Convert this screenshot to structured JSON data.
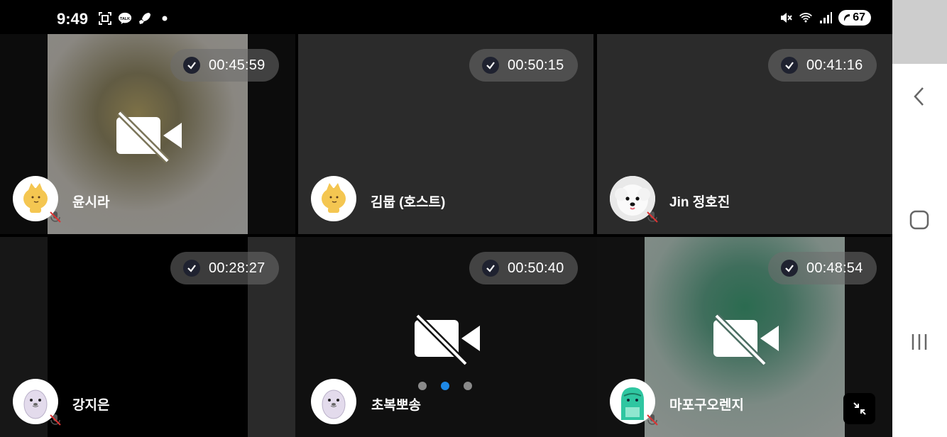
{
  "status": {
    "time": "9:49",
    "battery": "67",
    "left_icons": [
      "screenshot-icon",
      "kakaotalk-icon",
      "rocket-icon",
      "dot-icon"
    ],
    "right_icons": [
      "mute-icon",
      "wifi-icon",
      "signal-icon"
    ]
  },
  "tiles": [
    {
      "name": "윤시라",
      "timer": "00:45:59",
      "camera_off": true,
      "avatar": "yellow-character"
    },
    {
      "name": "김뭅 (호스트)",
      "timer": "00:50:15",
      "camera_off": false,
      "avatar": "yellow-character"
    },
    {
      "name": "Jin 정호진",
      "timer": "00:41:16",
      "camera_off": false,
      "avatar": "white-dog-photo"
    },
    {
      "name": "강지은",
      "timer": "00:28:27",
      "camera_off": false,
      "avatar": "seal-character"
    },
    {
      "name": "초복뽀송",
      "timer": "00:50:40",
      "camera_off": true,
      "avatar": "seal-character"
    },
    {
      "name": "마포구오렌지",
      "timer": "00:48:54",
      "camera_off": true,
      "avatar": "green-character"
    }
  ],
  "pagination": {
    "total": 3,
    "active": 2
  },
  "colors": {
    "accent": "#1e88e5",
    "timer_pill": "#6e6e6e",
    "tile_dark": "#2b2b2b"
  },
  "nav": [
    "back-icon",
    "home-icon",
    "recents-icon"
  ]
}
